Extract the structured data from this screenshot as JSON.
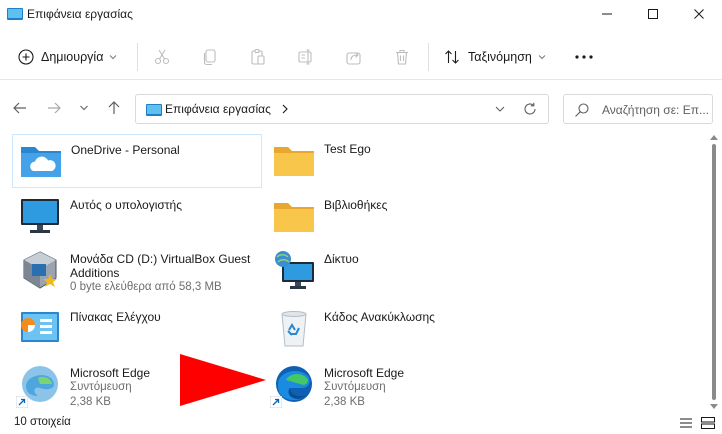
{
  "window": {
    "title": "Επιφάνεια εργασίας"
  },
  "toolbar": {
    "new_label": "Δημιουργία",
    "sort_label": "Ταξινόμηση"
  },
  "address": {
    "path": "Επιφάνεια εργασίας"
  },
  "search": {
    "placeholder": "Αναζήτηση σε: Επ..."
  },
  "items": [
    {
      "name": "OneDrive - Personal",
      "icon": "onedrive-folder-icon"
    },
    {
      "name": "Test Ego",
      "icon": "folder-icon"
    },
    {
      "name": "Αυτός ο υπολογιστής",
      "icon": "computer-icon"
    },
    {
      "name": "Βιβλιοθήκες",
      "icon": "libraries-folder-icon"
    },
    {
      "name": "Μονάδα CD (D:) VirtualBox Guest",
      "name2": "Additions",
      "detail": "0 byte ελεύθερα από 58,3 MB",
      "icon": "virtualbox-disc-icon"
    },
    {
      "name": "Δίκτυο",
      "icon": "network-icon"
    },
    {
      "name": "Πίνακας Ελέγχου",
      "icon": "control-panel-icon"
    },
    {
      "name": "Κάδος Ανακύκλωσης",
      "icon": "recycle-bin-icon"
    },
    {
      "name": "Microsoft Edge",
      "type": "Συντόμευση",
      "size": "2,38 KB",
      "icon": "edge-legacy-icon"
    },
    {
      "name": "Microsoft Edge",
      "type": "Συντόμευση",
      "size": "2,38 KB",
      "icon": "edge-icon"
    }
  ],
  "status": {
    "count": "10 στοιχεία"
  },
  "colors": {
    "folder": "#f7c64b",
    "accent": "#0067c0",
    "annotation_arrow": "#ff0000"
  }
}
